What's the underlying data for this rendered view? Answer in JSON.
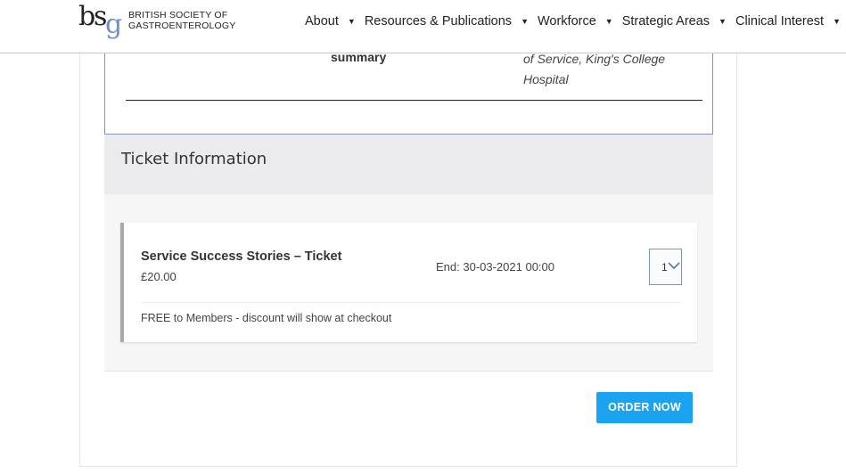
{
  "header": {
    "logo_letters": "bsg",
    "logo_line1": "BRITISH SOCIETY OF",
    "logo_line2": "GASTROENTEROLOGY",
    "nav": [
      {
        "label": "About",
        "has_dropdown": true
      },
      {
        "label": "Resources & Publications",
        "has_dropdown": true
      },
      {
        "label": "Workforce",
        "has_dropdown": true
      },
      {
        "label": "Strategic Areas",
        "has_dropdown": true
      },
      {
        "label": "Clinical Interest",
        "has_dropdown": true
      }
    ],
    "caret": "▼"
  },
  "schedule": {
    "title": "summary",
    "speaker_line1": "of Service, King's College",
    "speaker_line2": "Hospital"
  },
  "tickets": {
    "heading": "Ticket Information",
    "items": [
      {
        "name": "Service Success Stories – Ticket",
        "price": "£20.00",
        "end": "End: 30-03-2021 00:00",
        "quantity": "1",
        "note": "FREE to Members - discount will show at checkout"
      }
    ]
  },
  "order_button": "ORDER NOW",
  "colors": {
    "accent": "#1aa3f0",
    "logo_g": "#6e8fc7",
    "border_blue": "#7d96b8"
  }
}
